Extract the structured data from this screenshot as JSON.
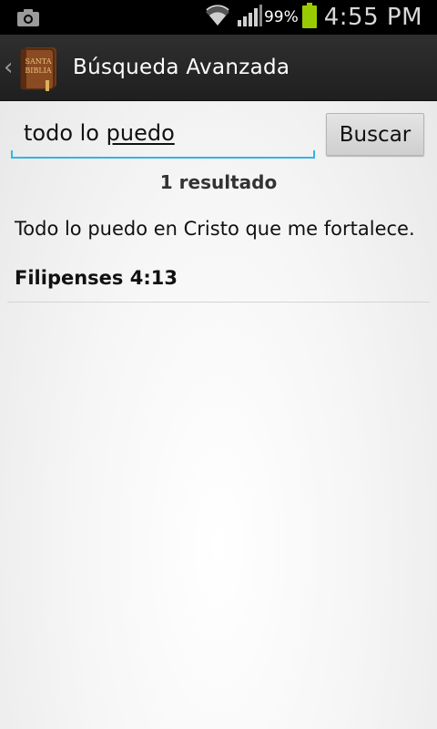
{
  "status_bar": {
    "battery_percent": "99%",
    "time": "4:55 PM",
    "icons": [
      "camera-icon",
      "wifi-icon",
      "signal-icon",
      "battery-icon"
    ]
  },
  "action_bar": {
    "title": "Búsqueda Avanzada",
    "app_icon_label": "SANTA BIBLIA"
  },
  "search": {
    "query_part1": "todo lo ",
    "query_part2": "puedo",
    "button_label": "Buscar"
  },
  "results": {
    "count_label": "1 resultado",
    "items": [
      {
        "text": "Todo lo puedo en Cristo que me fortalece.",
        "reference": "Filipenses 4:13"
      }
    ]
  },
  "colors": {
    "accent": "#33b5e5",
    "action_bar": "#262626",
    "status_bar": "#000000",
    "battery": "#99cc00"
  }
}
